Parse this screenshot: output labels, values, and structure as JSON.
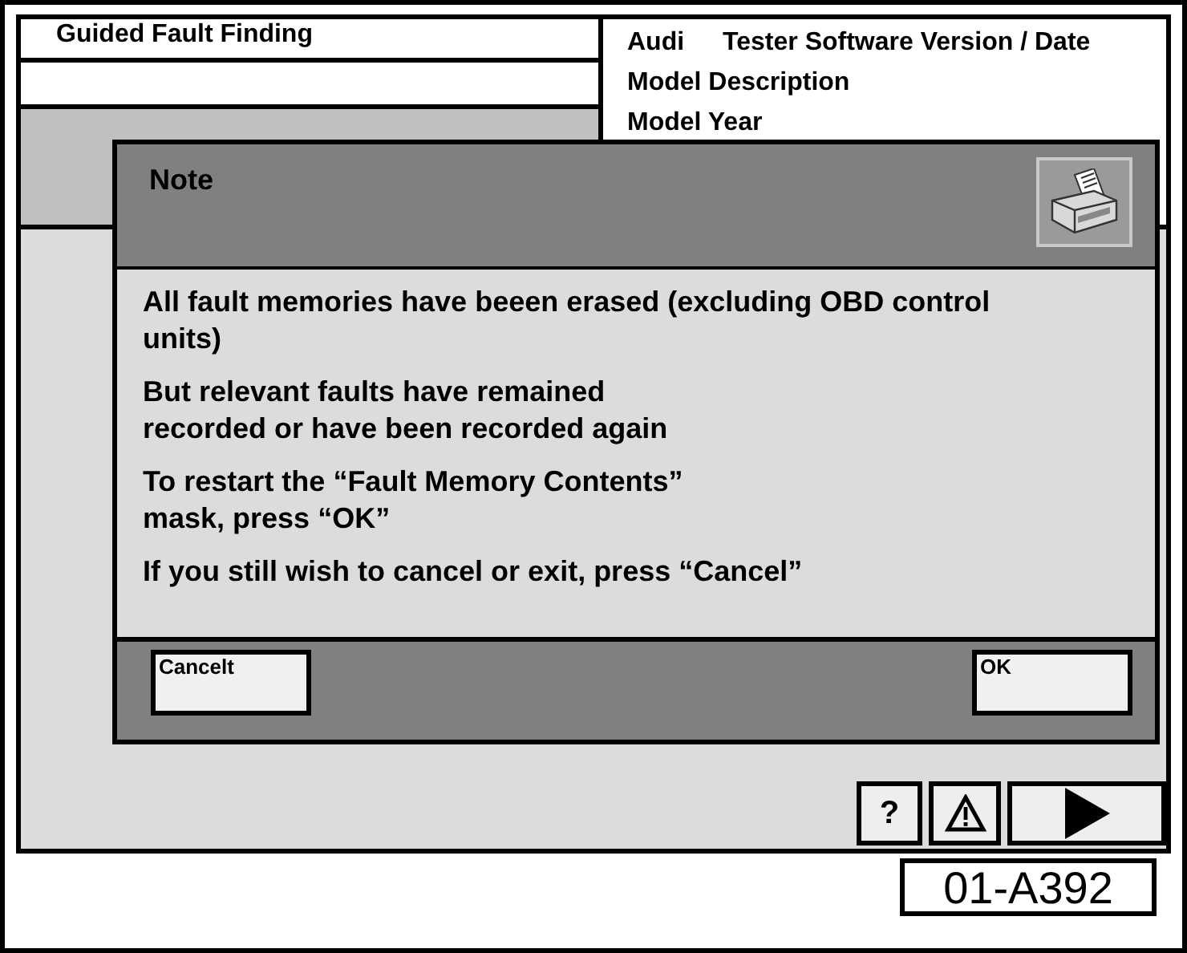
{
  "header": {
    "title": "Guided Fault Finding",
    "brand": "Audi",
    "version": "Tester Software Version / Date",
    "model_description": "Model Description",
    "model_year": "Model Year"
  },
  "dialog": {
    "title": "Note",
    "messages": [
      "All fault memories have beeen erased (excluding OBD control units)",
      "But relevant faults have remained\nrecorded or have been recorded again",
      "To restart the “Fault Memory Contents”\nmask, press “OK”",
      "If you still wish to cancel or exit, press “Cancel”"
    ],
    "buttons": [
      {
        "label": "Cancelt"
      },
      {
        "label": "OK"
      }
    ]
  },
  "toolbar": [
    {
      "kind": "help",
      "label": "?"
    },
    {
      "kind": "warning"
    },
    {
      "kind": "next"
    }
  ],
  "figure_id": "01-A392"
}
